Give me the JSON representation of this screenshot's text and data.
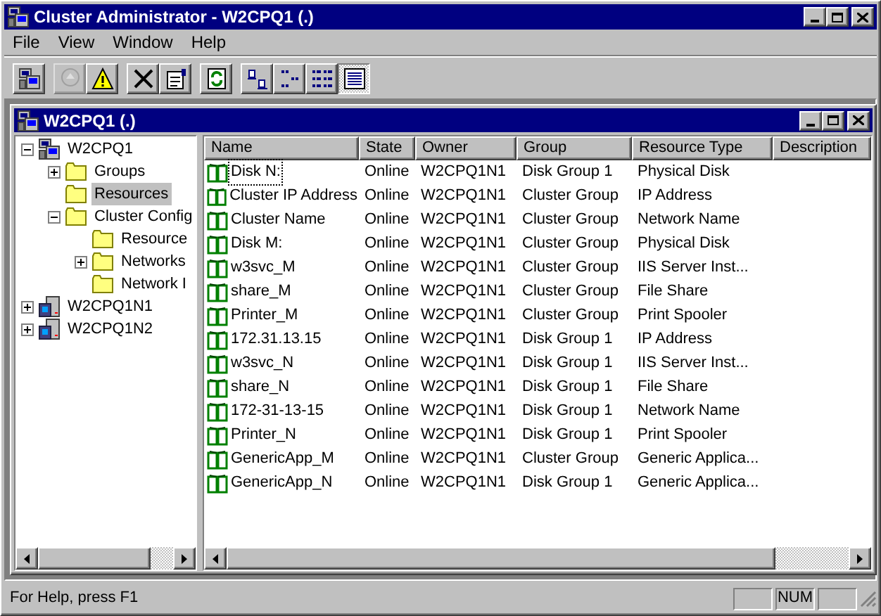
{
  "window": {
    "title": "Cluster Administrator - W2CPQ1 (.)"
  },
  "menu": [
    "File",
    "View",
    "Window",
    "Help"
  ],
  "toolbar": [
    [
      {
        "disabled": false,
        "selected": false
      }
    ],
    [
      {
        "disabled": true,
        "selected": false
      },
      {
        "disabled": false,
        "selected": false
      }
    ],
    [
      {
        "disabled": false,
        "selected": false
      },
      {
        "disabled": false,
        "selected": false
      }
    ],
    [
      {
        "disabled": false,
        "selected": false
      }
    ],
    [
      {
        "disabled": false,
        "selected": false
      },
      {
        "disabled": false,
        "selected": false
      },
      {
        "disabled": false,
        "selected": false
      },
      {
        "disabled": false,
        "selected": true
      }
    ]
  ],
  "child_window": {
    "title": "W2CPQ1 (.)"
  },
  "tree": [
    {
      "label": "W2CPQ1",
      "kind": "cluster",
      "selected": false,
      "expanded": true,
      "children": [
        {
          "label": "Groups",
          "kind": "folder",
          "selected": false,
          "expanded": false
        },
        {
          "label": "Resources",
          "kind": "folder",
          "selected": true
        },
        {
          "label": "Cluster Config",
          "kind": "folder",
          "selected": false,
          "expanded": true,
          "children": [
            {
              "label": "Resource",
              "kind": "folder",
              "selected": false
            },
            {
              "label": "Networks",
              "kind": "folder",
              "selected": false,
              "expanded": false
            },
            {
              "label": "Network I",
              "kind": "folder",
              "selected": false
            }
          ]
        }
      ]
    },
    {
      "label": "W2CPQ1N1",
      "kind": "node",
      "selected": false,
      "expanded": false
    },
    {
      "label": "W2CPQ1N2",
      "kind": "node",
      "selected": false,
      "expanded": false
    }
  ],
  "table": {
    "columns": [
      "Name",
      "State",
      "Owner",
      "Group",
      "Resource Type",
      "Description"
    ],
    "rows": [
      {
        "selected": true,
        "cells": [
          "Disk N:",
          "Online",
          "W2CPQ1N1",
          "Disk Group 1",
          "Physical Disk"
        ]
      },
      {
        "selected": false,
        "cells": [
          "Cluster IP Address",
          "Online",
          "W2CPQ1N1",
          "Cluster Group",
          "IP Address"
        ]
      },
      {
        "selected": false,
        "cells": [
          "Cluster Name",
          "Online",
          "W2CPQ1N1",
          "Cluster Group",
          "Network Name"
        ]
      },
      {
        "selected": false,
        "cells": [
          "Disk M:",
          "Online",
          "W2CPQ1N1",
          "Cluster Group",
          "Physical Disk"
        ]
      },
      {
        "selected": false,
        "cells": [
          "w3svc_M",
          "Online",
          "W2CPQ1N1",
          "Cluster Group",
          "IIS Server Inst..."
        ]
      },
      {
        "selected": false,
        "cells": [
          "share_M",
          "Online",
          "W2CPQ1N1",
          "Cluster Group",
          "File Share"
        ]
      },
      {
        "selected": false,
        "cells": [
          "Printer_M",
          "Online",
          "W2CPQ1N1",
          "Cluster Group",
          "Print Spooler"
        ]
      },
      {
        "selected": false,
        "cells": [
          "172.31.13.15",
          "Online",
          "W2CPQ1N1",
          "Disk Group 1",
          "IP Address"
        ]
      },
      {
        "selected": false,
        "cells": [
          "w3svc_N",
          "Online",
          "W2CPQ1N1",
          "Disk Group 1",
          "IIS Server Inst..."
        ]
      },
      {
        "selected": false,
        "cells": [
          "share_N",
          "Online",
          "W2CPQ1N1",
          "Disk Group 1",
          "File Share"
        ]
      },
      {
        "selected": false,
        "cells": [
          "172-31-13-15",
          "Online",
          "W2CPQ1N1",
          "Disk Group 1",
          "Network Name"
        ]
      },
      {
        "selected": false,
        "cells": [
          "Printer_N",
          "Online",
          "W2CPQ1N1",
          "Disk Group 1",
          "Print Spooler"
        ]
      },
      {
        "selected": false,
        "cells": [
          "GenericApp_M",
          "Online",
          "W2CPQ1N1",
          "Cluster Group",
          "Generic Applica..."
        ]
      },
      {
        "selected": false,
        "cells": [
          "GenericApp_N",
          "Online",
          "W2CPQ1N1",
          "Disk Group 1",
          "Generic Applica..."
        ]
      }
    ]
  },
  "status_bar": {
    "text": "For Help, press F1",
    "indicator": "NUM"
  }
}
